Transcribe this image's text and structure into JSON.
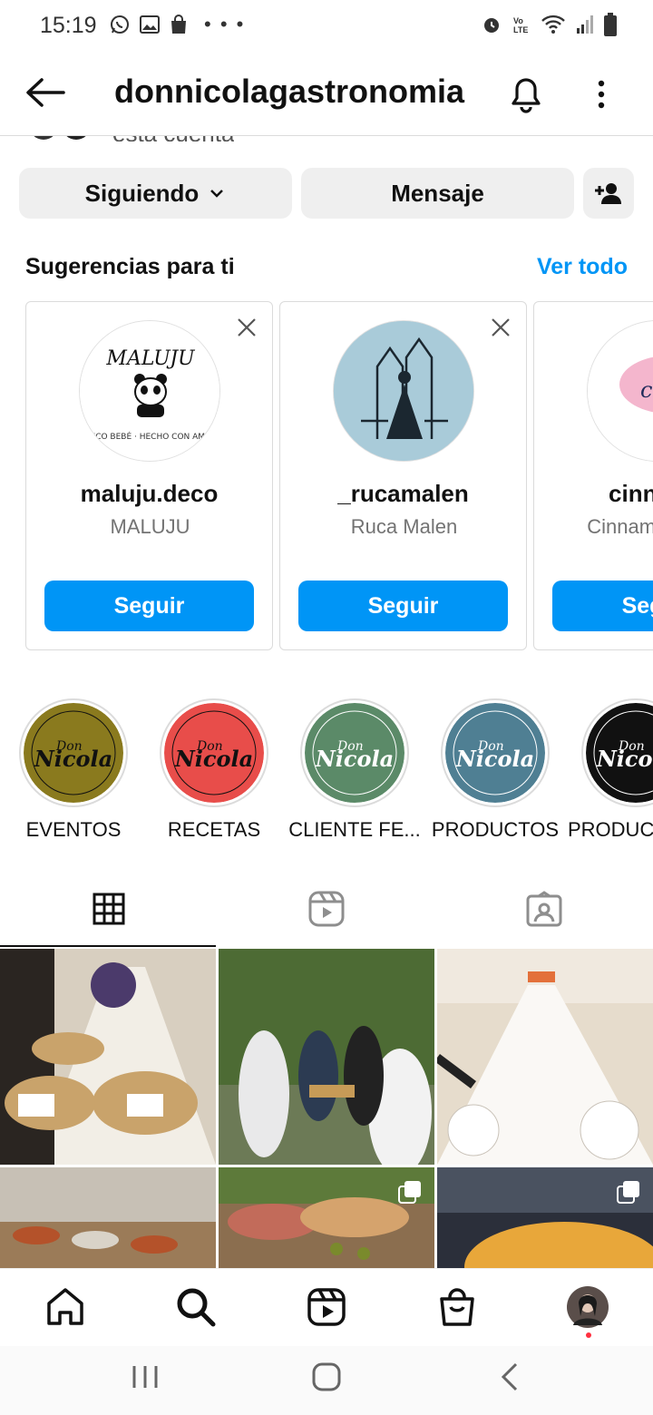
{
  "status": {
    "time": "15:19"
  },
  "header": {
    "username": "donnicolagastronomia"
  },
  "profile": {
    "partial_text": "esta cuenta"
  },
  "actions": {
    "following_label": "Siguiendo",
    "message_label": "Mensaje"
  },
  "suggestions": {
    "title": "Sugerencias para ti",
    "see_all": "Ver todo",
    "cards": [
      {
        "username": "maluju.deco",
        "fullname": "MALUJU",
        "follow": "Seguir",
        "avatar_text": "MALUJU"
      },
      {
        "username": "_rucamalen",
        "fullname": "Ruca Malen",
        "follow": "Seguir"
      },
      {
        "username": "cinnamo",
        "fullname": "Cinnamon Artes",
        "follow": "Seguir",
        "avatar_text": "cinn"
      }
    ]
  },
  "highlights": [
    {
      "label": "EVENTOS",
      "color": "#8a7a1e",
      "brand_top": "Don",
      "brand": "Nicola"
    },
    {
      "label": "RECETAS",
      "color": "#e84d4a",
      "brand_top": "Don",
      "brand": "Nicola"
    },
    {
      "label": "CLIENTE FE...",
      "color": "#5b8a68",
      "brand_top": "Don",
      "brand": "Nicola"
    },
    {
      "label": "PRODUCTOS",
      "color": "#4f7f93",
      "brand_top": "Don",
      "brand": "Nicola"
    },
    {
      "label": "PRODUC",
      "color": "#111111",
      "brand_top": "Don",
      "brand": "Nicola"
    }
  ],
  "tabs": [
    "grid-icon",
    "reels-icon",
    "tagged-icon"
  ],
  "colors": {
    "accent": "#0095f6",
    "border": "#dbdbdb"
  }
}
